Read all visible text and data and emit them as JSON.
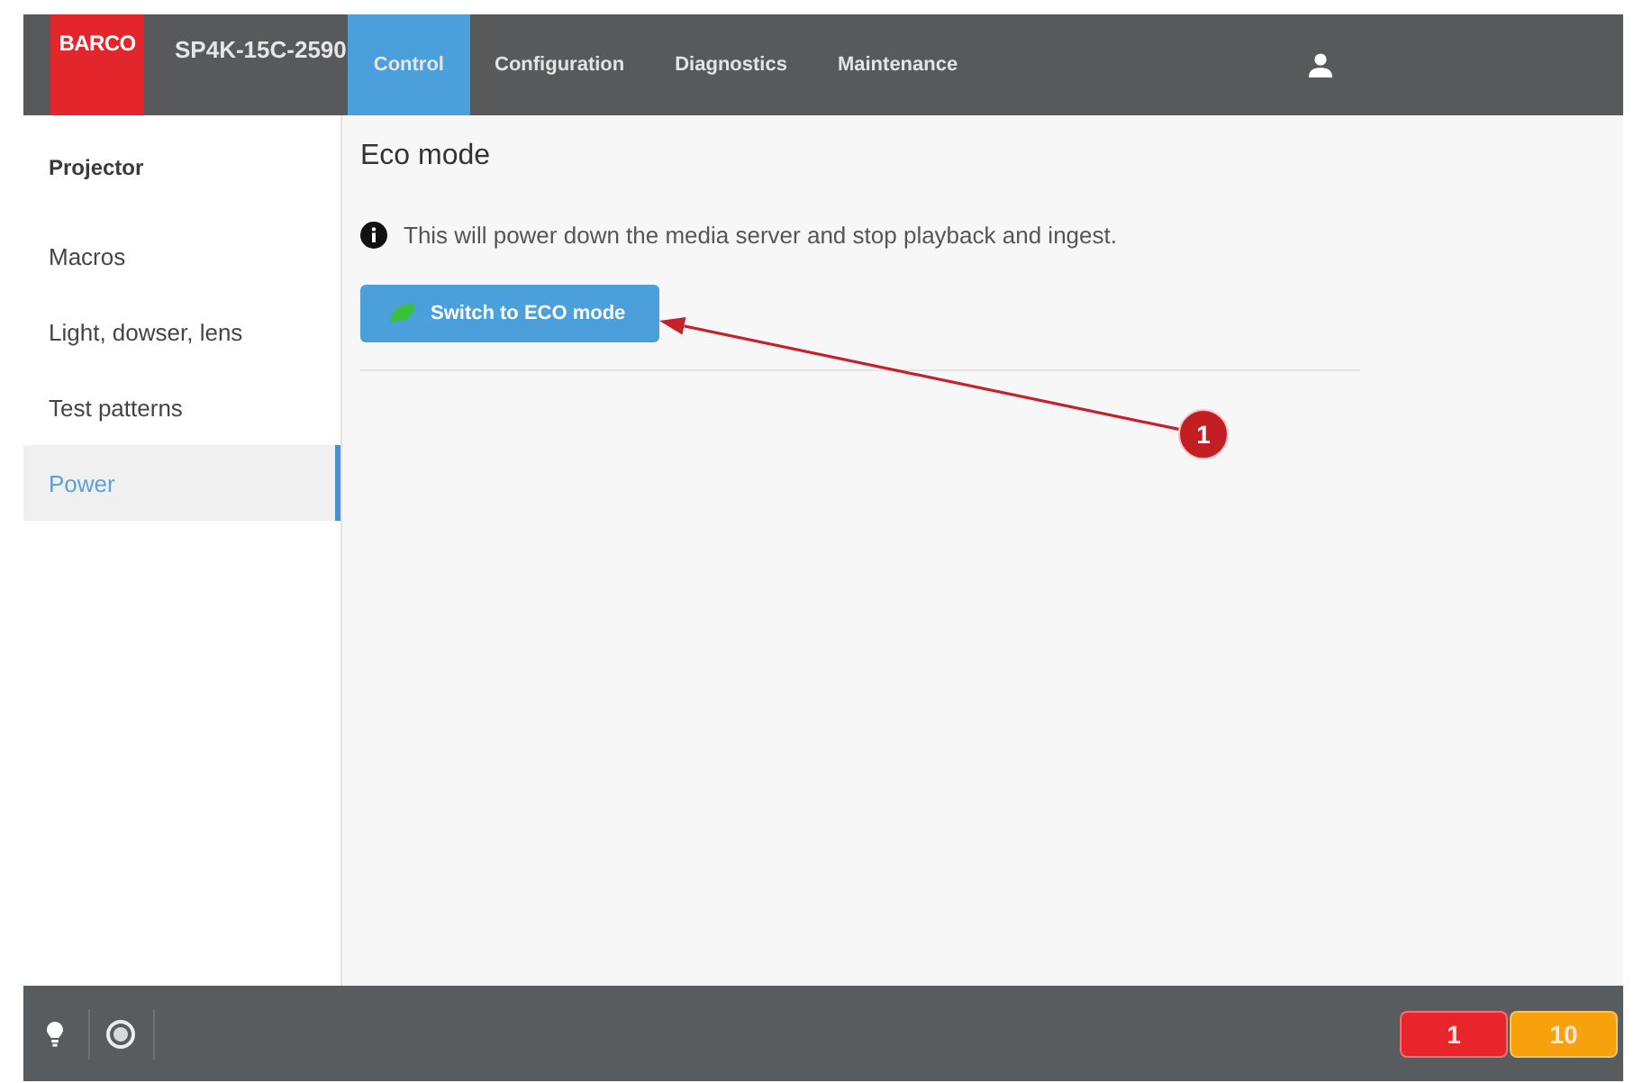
{
  "header": {
    "logo": "BARCO",
    "device_name": "SP4K-15C-2590",
    "tabs": [
      {
        "label": "Control",
        "selected": true
      },
      {
        "label": "Configuration",
        "selected": false
      },
      {
        "label": "Diagnostics",
        "selected": false
      },
      {
        "label": "Maintenance",
        "selected": false
      }
    ]
  },
  "sidebar": {
    "heading": "Projector",
    "items": [
      {
        "label": "Macros",
        "selected": false
      },
      {
        "label": "Light, dowser, lens",
        "selected": false
      },
      {
        "label": "Test patterns",
        "selected": false
      },
      {
        "label": "Power",
        "selected": true
      }
    ]
  },
  "content": {
    "title": "Eco mode",
    "info": "This will power down the media server and stop playback and ingest.",
    "button": "Switch to ECO mode"
  },
  "callout": {
    "label": "1"
  },
  "footer": {
    "badges": [
      {
        "count": "1",
        "color": "#e8252b"
      },
      {
        "count": "10",
        "color": "#f7a10c"
      }
    ]
  }
}
